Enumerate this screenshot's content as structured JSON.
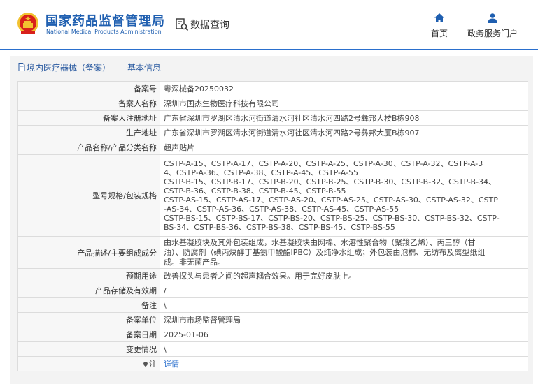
{
  "header": {
    "logo_cn": "国家药品监督管理局",
    "logo_en": "National Medical Products Administration",
    "query_label": "数据查询",
    "nav": [
      {
        "label": "首页",
        "icon": "home-icon"
      },
      {
        "label": "政务服务门户",
        "icon": "user-icon"
      }
    ]
  },
  "breadcrumb": "境内医疗器械（备案）——基本信息",
  "fields": {
    "record_no": {
      "label": "备案号",
      "value": "粤深械备20250032"
    },
    "registrant": {
      "label": "备案人名称",
      "value": "深圳市国杰生物医疗科技有限公司"
    },
    "reg_address": {
      "label": "备案人注册地址",
      "value": "广东省深圳市罗湖区清水河街道清水河社区清水河四路2号彝邦大楼B栋908"
    },
    "prod_address": {
      "label": "生产地址",
      "value": "广东省深圳市罗湖区清水河街道清水河社区清水河四路2号彝邦大厦B栋907"
    },
    "product_name": {
      "label": "产品名称/产品分类名称",
      "value": "超声贴片"
    },
    "model_spec": {
      "label": "型号规格/包装规格",
      "lines": [
        "CSTP-A-15、CSTP-A-17、CSTP-A-20、CSTP-A-25、CSTP-A-30、CSTP-A-32、CSTP-A-3",
        "4、CSTP-A-36、CSTP-A-38、CSTP-A-45、CSTP-A-55",
        "CSTP-B-15、CSTP-B-17、CSTP-B-20、CSTP-B-25、CSTP-B-30、CSTP-B-32、CSTP-B-34、",
        "CSTP-B-36、CSTP-B-38、CSTP-B-45、CSTP-B-55",
        "CSTP-AS-15、CSTP-AS-17、CSTP-AS-20、CSTP-AS-25、CSTP-AS-30、CSTP-AS-32、CSTP",
        "-AS-34、CSTP-AS-36、CSTP-AS-38、CSTP-AS-45、CSTP-AS-55",
        "CSTP-BS-15、CSTP-BS-17、CSTP-BS-20、CSTP-BS-25、CSTP-BS-30、CSTP-BS-32、CSTP-",
        "BS-34、CSTP-BS-36、CSTP-BS-38、CSTP-BS-45、CSTP-BS-55"
      ]
    },
    "description": {
      "label": "产品描述/主要组成成分",
      "lines": [
        "由水基凝胶块及其外包装组成，水基凝胶块由网棉、水溶性聚合物（聚羧乙烯）、丙三醇（甘",
        "油）、防腐剂（碘丙炔醇丁基氨甲酸酯IPBC）及纯净水组成；外包装由泡棉、无纺布及离型纸组",
        "成。非无菌产品。"
      ]
    },
    "intended_use": {
      "label": "预期用途",
      "value": "改善探头与患者之间的超声耦合效果。用于完好皮肤上。"
    },
    "storage": {
      "label": "产品存储及有效期",
      "value": "/"
    },
    "remark": {
      "label": "备注",
      "value": "\\"
    },
    "authority": {
      "label": "备案单位",
      "value": "深圳市市场监督管理局"
    },
    "record_date": {
      "label": "备案日期",
      "value": "2025-01-06"
    },
    "changes": {
      "label": "变更情况",
      "value": "\\"
    },
    "note": {
      "label": "注",
      "value": "详情"
    }
  },
  "colors": {
    "brand": "#1f5fb0",
    "accent": "#2a6fcd",
    "emblem_red": "#d8201b",
    "emblem_gold": "#f2c230"
  }
}
